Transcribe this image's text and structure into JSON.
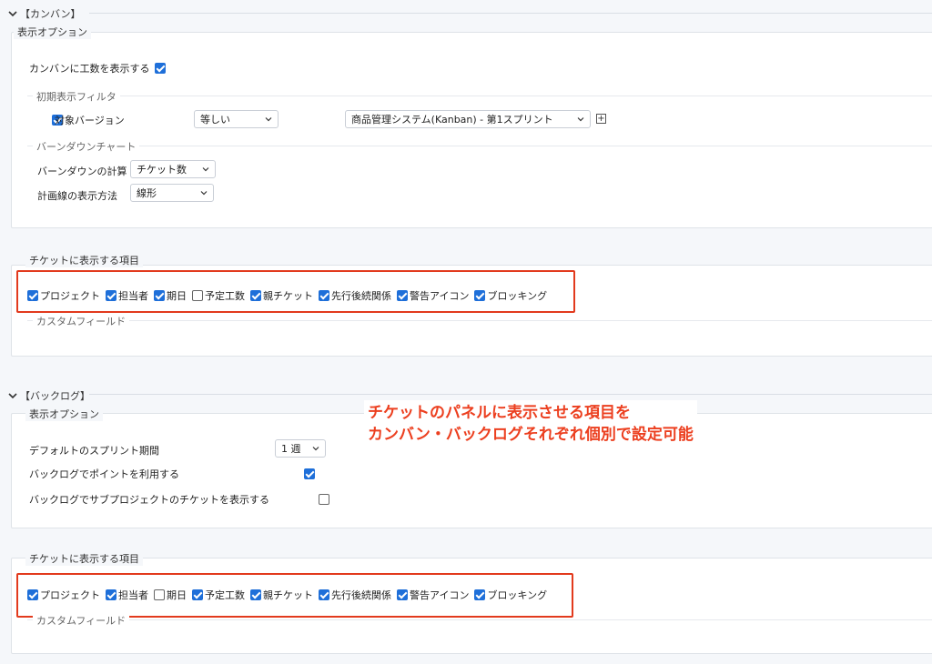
{
  "kanban": {
    "section_title": "【カンバン】",
    "display_options": {
      "legend": "表示オプション",
      "show_effort_label": "カンバンに工数を表示する",
      "show_effort_checked": true,
      "initial_filter": {
        "legend": "初期表示フィルタ",
        "target_version_label": "対象バージョン",
        "target_version_checked": true,
        "operator_value": "等しい",
        "version_value": "商品管理システム(Kanban) - 第1スプリント"
      },
      "burndown": {
        "legend": "バーンダウンチャート",
        "calc_label": "バーンダウンの計算",
        "calc_value": "チケット数",
        "plan_label": "計画線の表示方法",
        "plan_value": "線形"
      }
    },
    "ticket_items": {
      "legend": "チケットに表示する項目",
      "items": [
        {
          "label": "プロジェクト",
          "checked": true
        },
        {
          "label": "担当者",
          "checked": true
        },
        {
          "label": "期日",
          "checked": true
        },
        {
          "label": "予定工数",
          "checked": false
        },
        {
          "label": "親チケット",
          "checked": true
        },
        {
          "label": "先行後続関係",
          "checked": true
        },
        {
          "label": "警告アイコン",
          "checked": true
        },
        {
          "label": "ブロッキング",
          "checked": true
        }
      ],
      "custom_field_legend": "カスタムフィールド"
    }
  },
  "backlog": {
    "section_title": "【バックログ】",
    "display_options": {
      "legend": "表示オプション",
      "sprint_period_label": "デフォルトのスプリント期間",
      "sprint_period_value": "1 週",
      "use_points_label": "バックログでポイントを利用する",
      "use_points_checked": true,
      "show_sub_label": "バックログでサブプロジェクトのチケットを表示する",
      "show_sub_checked": false
    },
    "ticket_items": {
      "legend": "チケットに表示する項目",
      "items": [
        {
          "label": "プロジェクト",
          "checked": true
        },
        {
          "label": "担当者",
          "checked": true
        },
        {
          "label": "期日",
          "checked": false
        },
        {
          "label": "予定工数",
          "checked": true
        },
        {
          "label": "親チケット",
          "checked": true
        },
        {
          "label": "先行後続関係",
          "checked": true
        },
        {
          "label": "警告アイコン",
          "checked": true
        },
        {
          "label": "ブロッキング",
          "checked": true
        }
      ],
      "custom_field_legend": "カスタムフィールド"
    }
  },
  "annotation": {
    "line1": "チケットのパネルに表示させる項目を",
    "line2": "カンバン・バックログそれぞれ個別で設定可能",
    "color": "#ec3f1f"
  },
  "colors": {
    "accent": "#1e6fd9",
    "highlight": "#e23a1d"
  }
}
